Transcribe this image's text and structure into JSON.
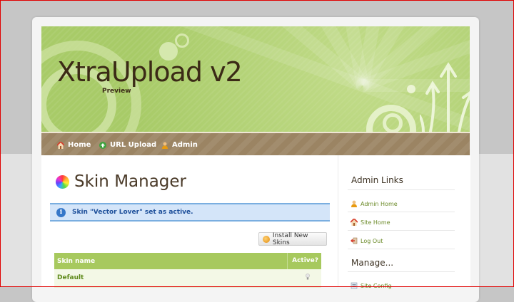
{
  "brand": {
    "title": "XtraUpload v2",
    "subtitle": "Preview"
  },
  "nav": {
    "items": [
      {
        "label": "Home",
        "icon": "home-icon"
      },
      {
        "label": "URL Upload",
        "icon": "url-upload-icon"
      },
      {
        "label": "Admin",
        "icon": "admin-user-icon"
      }
    ]
  },
  "main": {
    "title": "Skin Manager",
    "notice": "Skin \"Vector Lover\" set as active.",
    "install_button": "Install New Skins",
    "table": {
      "columns": [
        "Skin name",
        "Active?"
      ],
      "rows": [
        {
          "name": "Default",
          "active_icon": "lightbulb-icon"
        }
      ]
    }
  },
  "sidebar": {
    "heading": "Admin Links",
    "links": [
      {
        "label": "Admin Home",
        "icon": "admin-user-icon"
      },
      {
        "label": "Site Home",
        "icon": "home-icon"
      },
      {
        "label": "Log Out",
        "icon": "logout-icon"
      }
    ],
    "heading2": "Manage...",
    "manage_links": [
      {
        "label": "Site Config",
        "icon": "config-icon"
      }
    ]
  },
  "colors": {
    "header_green": "#a8cb68",
    "nav_brown": "#9b8463",
    "table_green": "#a7c95e",
    "link_green": "#6b8a28",
    "notice_blue": "#d4e5f9"
  }
}
